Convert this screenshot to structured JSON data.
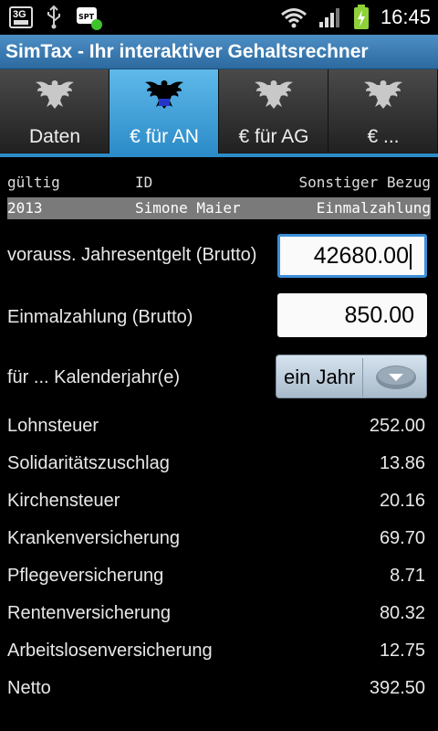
{
  "status_bar": {
    "network": "3G",
    "time": "16:45",
    "icons": [
      "3g-icon",
      "usb-icon",
      "app-notification-icon",
      "wifi-icon",
      "signal-icon",
      "battery-charging-icon"
    ]
  },
  "app": {
    "title": "SimTax - Ihr interaktiver Gehaltsrechner"
  },
  "tabs": [
    {
      "label": "Daten",
      "active": false
    },
    {
      "label": "€ für AN",
      "active": true
    },
    {
      "label": "€ für AG",
      "active": false
    },
    {
      "label": "€ ...",
      "active": false
    }
  ],
  "header": {
    "labels": {
      "valid": "gültig",
      "id": "ID",
      "other": "Sonstiger Bezug"
    },
    "values": {
      "valid": "2013",
      "id": "Simone Maier",
      "other": "Einmalzahlung"
    }
  },
  "form": {
    "annual_income": {
      "label": "vorauss. Jahresentgelt (Brutto)",
      "value": "42680.00"
    },
    "one_time": {
      "label": "Einmalzahlung (Brutto)",
      "value": "850.00"
    },
    "years": {
      "label": "für ... Kalenderjahr(e)",
      "value": "ein Jahr"
    }
  },
  "results": [
    {
      "label": "Lohnsteuer",
      "value": "252.00"
    },
    {
      "label": "Solidaritätszuschlag",
      "value": "13.86"
    },
    {
      "label": "Kirchensteuer",
      "value": "20.16"
    },
    {
      "label": "Krankenversicherung",
      "value": "69.70"
    },
    {
      "label": "Pflegeversicherung",
      "value": "8.71"
    },
    {
      "label": "Rentenversicherung",
      "value": "80.32"
    },
    {
      "label": "Arbeitslosenversicherung",
      "value": "12.75"
    },
    {
      "label": "Netto",
      "value": "392.50"
    }
  ],
  "colors": {
    "title_bar": "#3a7db5",
    "active_tab": "#3fa3dc",
    "focus_border": "#3d8fd8"
  }
}
